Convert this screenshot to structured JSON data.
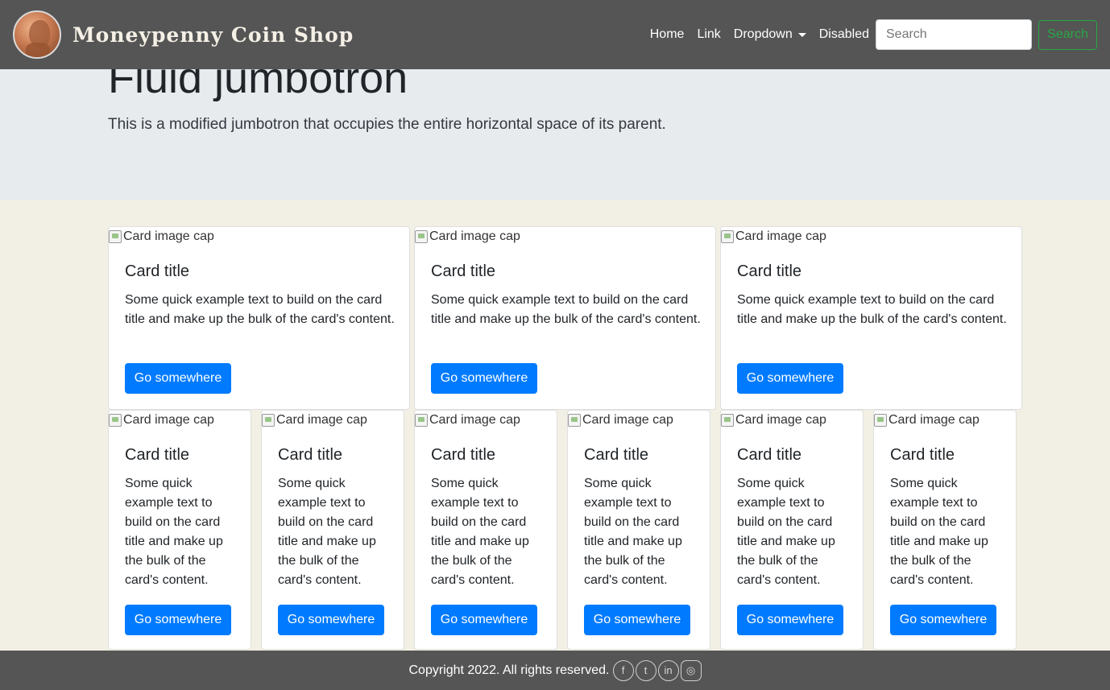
{
  "navbar": {
    "brand": "Moneypenny Coin Shop",
    "links": [
      "Home",
      "Link",
      "Dropdown",
      "Disabled"
    ],
    "search_placeholder": "Search",
    "search_button": "Search"
  },
  "jumbotron": {
    "title": "Fluid jumbotron",
    "lead": "This is a modified jumbotron that occupies the entire horizontal space of its parent."
  },
  "cards_row1": [
    {
      "img_alt": "Card image cap",
      "title": "Card title",
      "text": "Some quick example text to build on the card title and make up the bulk of the card's content.",
      "button": "Go somewhere"
    },
    {
      "img_alt": "Card image cap",
      "title": "Card title",
      "text": "Some quick example text to build on the card title and make up the bulk of the card's content.",
      "button": "Go somewhere"
    },
    {
      "img_alt": "Card image cap",
      "title": "Card title",
      "text": "Some quick example text to build on the card title and make up the bulk of the card's content.",
      "button": "Go somewhere"
    }
  ],
  "cards_row2": [
    {
      "img_alt": "Card image cap",
      "title": "Card title",
      "text": "Some quick example text to build on the card title and make up the bulk of the card's content.",
      "button": "Go somewhere"
    },
    {
      "img_alt": "Card image cap",
      "title": "Card title",
      "text": "Some quick example text to build on the card title and make up the bulk of the card's content.",
      "button": "Go somewhere"
    },
    {
      "img_alt": "Card image cap",
      "title": "Card title",
      "text": "Some quick example text to build on the card title and make up the bulk of the card's content.",
      "button": "Go somewhere"
    },
    {
      "img_alt": "Card image cap",
      "title": "Card title",
      "text": "Some quick example text to build on the card title and make up the bulk of the card's content.",
      "button": "Go somewhere"
    },
    {
      "img_alt": "Card image cap",
      "title": "Card title",
      "text": "Some quick example text to build on the card title and make up the bulk of the card's content.",
      "button": "Go somewhere"
    },
    {
      "img_alt": "Card image cap",
      "title": "Card title",
      "text": "Some quick example text to build on the card title and make up the bulk of the card's content.",
      "button": "Go somewhere"
    }
  ],
  "footer": {
    "copyright": "Copyright 2022. All rights reserved.",
    "social_icons": [
      "facebook-icon",
      "twitter-icon",
      "linkedin-icon",
      "instagram-icon"
    ]
  },
  "colors": {
    "navbar_bg": "#555555",
    "jumbotron_bg": "#e8ebee",
    "page_bg": "#f2f0e4",
    "primary": "#007bff",
    "success": "#28a745"
  }
}
